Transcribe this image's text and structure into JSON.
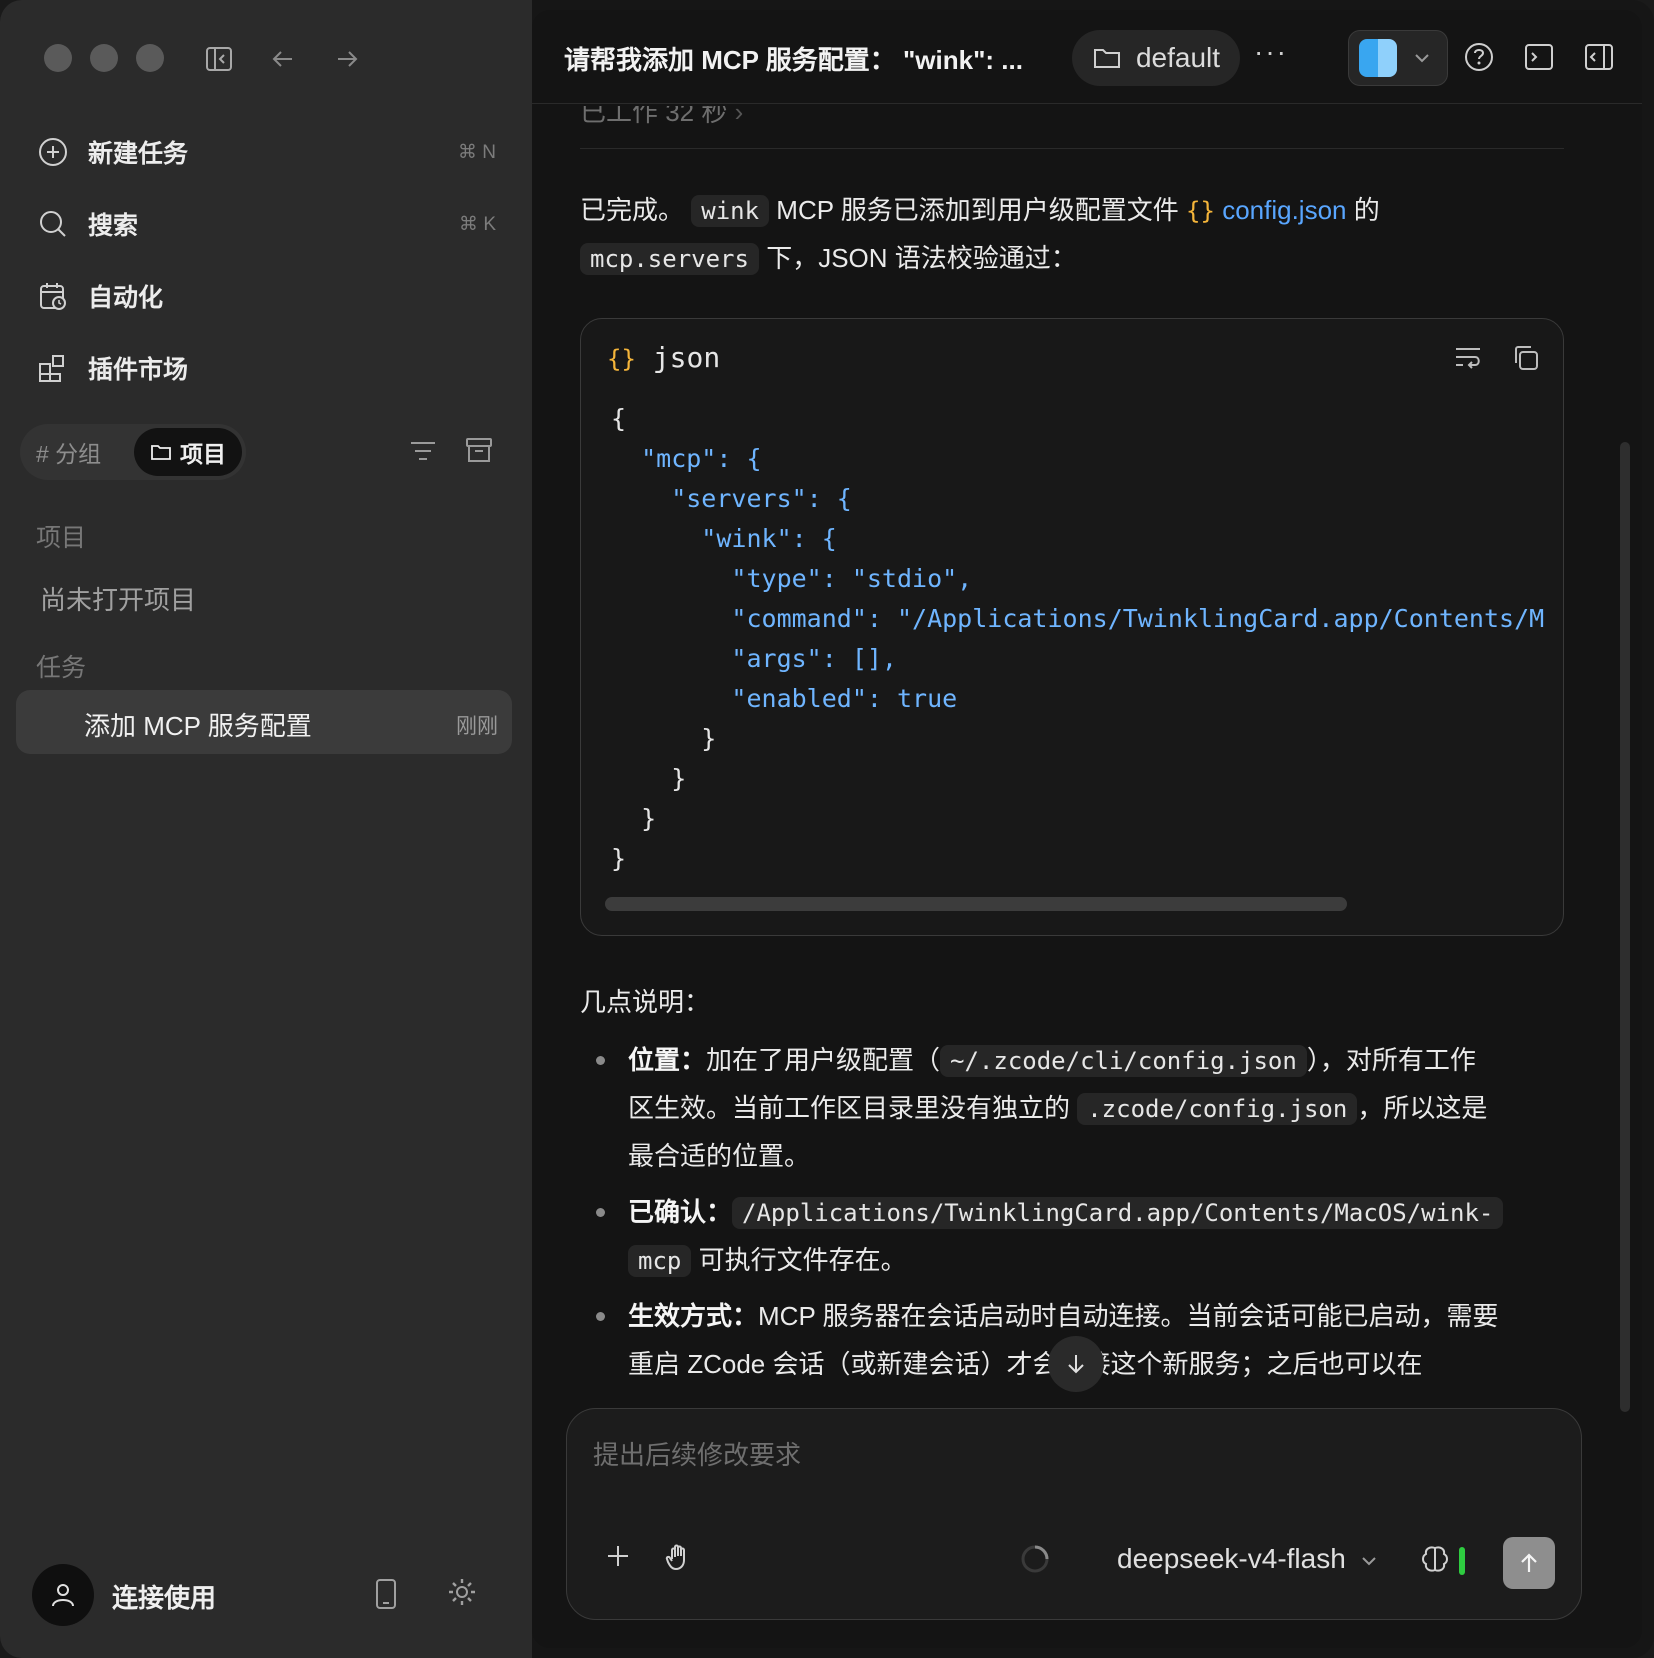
{
  "sidebar": {
    "nav": [
      {
        "label": "新建任务",
        "shortcut": "⌘ N",
        "icon": "new-task-icon"
      },
      {
        "label": "搜索",
        "shortcut": "⌘ K",
        "icon": "search-icon"
      },
      {
        "label": "自动化",
        "shortcut": "",
        "icon": "automation-icon"
      },
      {
        "label": "插件市场",
        "shortcut": "",
        "icon": "plugin-icon"
      }
    ],
    "segment": {
      "groups": "# 分组",
      "projects": "项目"
    },
    "projects_title": "项目",
    "no_projects": "尚未打开项目",
    "tasks_title": "任务",
    "task": {
      "label": "添加 MCP 服务配置",
      "time": "刚刚"
    },
    "footer_label": "连接使用"
  },
  "header": {
    "title": "请帮我添加 MCP 服务配置： \"wink\": ...",
    "folder": "default",
    "more": "···"
  },
  "content": {
    "worked": "已工作 32 秒",
    "intro": {
      "p1_a": "已完成。",
      "p1_code": "wink",
      "p1_b": " MCP 服务已添加到用户级配置文件 ",
      "p1_link": "config.json",
      "p1_c": " 的",
      "p2_code": "mcp.servers",
      "p2_b": " 下，JSON 语法校验通过："
    },
    "code": {
      "lang": "json",
      "lines": [
        "{",
        "  \"mcp\": {",
        "    \"servers\": {",
        "      \"wink\": {",
        "        \"type\": \"stdio\",",
        "        \"command\": \"/Applications/TwinklingCard.app/Contents/M",
        "        \"args\": [],",
        "        \"enabled\": true",
        "      }",
        "    }",
        "  }",
        "}"
      ]
    },
    "notes_title": "几点说明：",
    "b1": {
      "head": "位置：",
      "l1a": "加在了用户级配置（",
      "l1code": "~/.zcode/cli/config.json",
      "l1b": "），对所有工作",
      "l2a": "区生效。当前工作区目录里没有独立的 ",
      "l2code": ".zcode/config.json",
      "l2b": "，所以这是",
      "l3": "最合适的位置。"
    },
    "b2": {
      "head": "已确认：",
      "l1code": "/Applications/TwinklingCard.app/Contents/MacOS/wink-",
      "l2code": "mcp",
      "l2b": " 可执行文件存在。"
    },
    "b3": {
      "head": "生效方式：",
      "l1": "MCP 服务器在会话启动时自动连接。当前会话可能已启动，需要",
      "l2": "重启 ZCode 会话（或新建会话）才会连接这个新服务；之后也可以在"
    }
  },
  "composer": {
    "placeholder": "提出后续修改要求",
    "model": "deepseek-v4-flash"
  },
  "colors": {
    "accent_link": "#59a6ff",
    "json_key": "#6fb5ff",
    "brace": "#f5b53a",
    "status_green": "#2ecc40"
  }
}
